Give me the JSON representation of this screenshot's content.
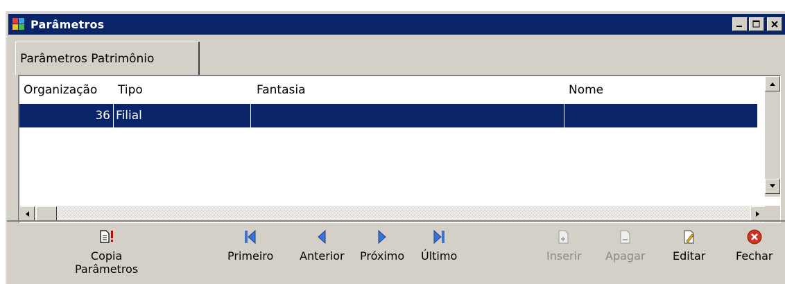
{
  "window": {
    "title": "Parâmetros"
  },
  "tabs": [
    {
      "label": "Parâmetros Patrimônio"
    }
  ],
  "grid": {
    "columns": [
      "Organização",
      "Tipo",
      "Fantasia",
      "Nome"
    ],
    "rows": [
      {
        "organizacao": "36",
        "tipo": "Filial",
        "fantasia": "",
        "nome": ""
      }
    ]
  },
  "toolbar": {
    "copia": {
      "label_line1": "Copia",
      "label_line2": "Parâmetros",
      "icon": "copy-parameters-icon"
    },
    "primeiro": {
      "label": "Primeiro",
      "icon": "first-record-icon"
    },
    "anterior": {
      "label": "Anterior",
      "icon": "previous-record-icon"
    },
    "proximo": {
      "label": "Próximo",
      "icon": "next-record-icon"
    },
    "ultimo": {
      "label": "Último",
      "icon": "last-record-icon"
    },
    "inserir": {
      "label": "Inserir",
      "icon": "insert-record-icon",
      "enabled": false
    },
    "apagar": {
      "label": "Apagar",
      "icon": "delete-record-icon",
      "enabled": false
    },
    "editar": {
      "label": "Editar",
      "icon": "edit-record-icon"
    },
    "fechar": {
      "label": "Fechar",
      "icon": "close-red-icon"
    }
  },
  "colors": {
    "titlebar": "#0a246a",
    "selection": "#0a246a",
    "face": "#d4d0c8",
    "nav_blue": "#3a73d6",
    "close_red": "#d03020"
  }
}
